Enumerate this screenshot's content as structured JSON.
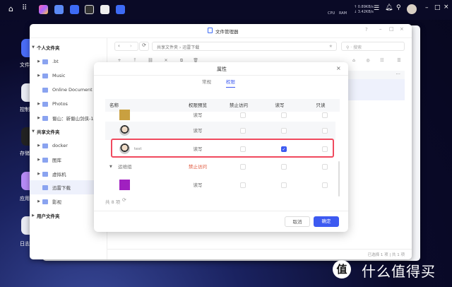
{
  "topbar": {
    "net_up": "↑ 0.89KB/s",
    "net_down": "↓ 3.42KB/s",
    "cpu": "CPU",
    "ram": "RAM"
  },
  "dock": [
    {
      "label": "文件"
    },
    {
      "label": "控制"
    },
    {
      "label": "存储"
    },
    {
      "label": "应用"
    },
    {
      "label": "日志"
    }
  ],
  "window": {
    "title": "文件管理器",
    "help": "?",
    "search_placeholder": "搜索",
    "breadcrumb": [
      "共享文件夹",
      "迅雷下载"
    ],
    "status_selected": "已选择 1 项",
    "status_sep": "|",
    "status_total": "共 1 项",
    "more": "···"
  },
  "sidebar": {
    "personal": {
      "label": "个人文件夹",
      "items": [
        {
          "label": ".bt"
        },
        {
          "label": "Music"
        },
        {
          "label": "Online Document"
        },
        {
          "label": "Photos"
        },
        {
          "label": "蜀山：新蜀山剑侠-1"
        }
      ]
    },
    "shared": {
      "label": "共享文件夹",
      "items": [
        {
          "label": "docker"
        },
        {
          "label": "图库"
        },
        {
          "label": "虚拟机"
        },
        {
          "label": "迅雷下载"
        },
        {
          "label": "影视"
        }
      ]
    },
    "user": {
      "label": "用户文件夹"
    }
  },
  "dialog": {
    "title": "属性",
    "tabs": [
      {
        "label": "常规"
      },
      {
        "label": "权限"
      }
    ],
    "active_tab": "权限",
    "columns": [
      "名称",
      "权限预览",
      "禁止访问",
      "读写",
      "只读"
    ],
    "rows": [
      {
        "name": "",
        "preview": "读写",
        "deny": false,
        "rw": false,
        "ro": false
      },
      {
        "name": "",
        "preview": "读写",
        "deny": false,
        "rw": false,
        "ro": false
      },
      {
        "name": "test",
        "preview": "读写",
        "deny": false,
        "rw": true,
        "ro": false
      },
      {
        "name": "运维组",
        "preview": "禁止访问",
        "deny": false,
        "rw": false,
        "ro": false,
        "group": true
      },
      {
        "name": "",
        "preview": "读写",
        "deny": false,
        "rw": false,
        "ro": false
      }
    ],
    "count": "共 8 项",
    "cancel": "取消",
    "ok": "确定"
  },
  "colors": {
    "accent": "#3d5af1",
    "highlight": "#f04a5e",
    "deny": "#e0553a"
  },
  "watermark": {
    "badge": "值",
    "text": "什么值得买"
  }
}
